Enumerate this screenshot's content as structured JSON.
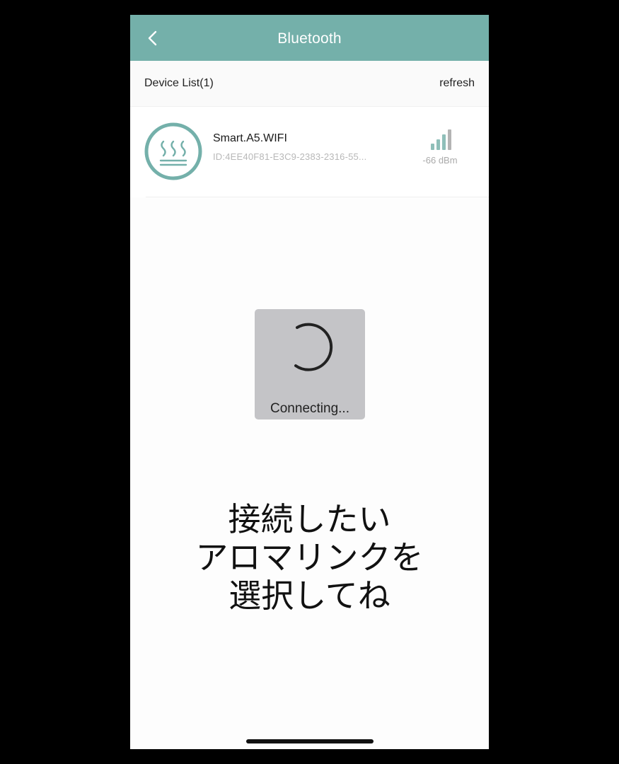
{
  "header": {
    "title": "Bluetooth",
    "back_icon": "chevron-left-icon"
  },
  "device_list": {
    "label": "Device List(1)",
    "refresh_label": "refresh",
    "devices": [
      {
        "name": "Smart.A5.WIFI",
        "id": "ID:4EE40F81-E3C9-2383-2316-55...",
        "signal": "-66 dBm",
        "icon": "steam-icon",
        "signal_icon": "signal-strength-icon"
      }
    ]
  },
  "loading": {
    "text": "Connecting..."
  },
  "caption": {
    "lines": [
      "接続したい",
      "アロマリンクを",
      "選択してね"
    ]
  },
  "colors": {
    "accent": "#74b0aa",
    "overlay": "#c4c4c7",
    "signal_bars": "#8fbfb9"
  }
}
